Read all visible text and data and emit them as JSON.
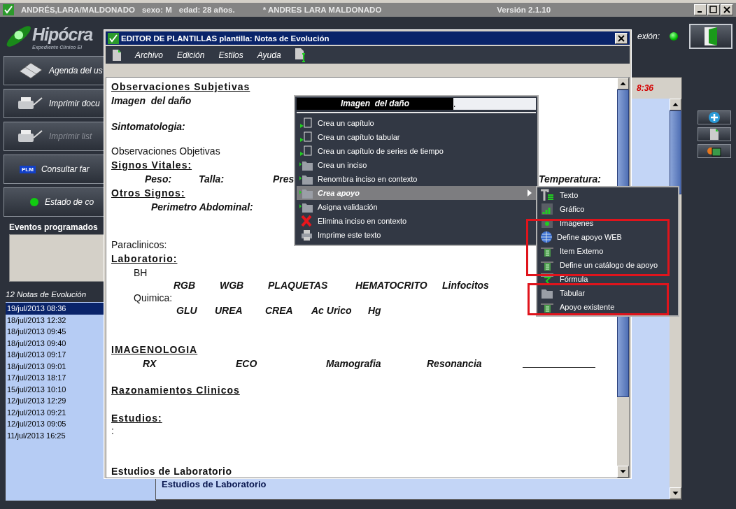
{
  "window": {
    "patient": "ANDRÉS,LARA/MALDONADO",
    "sex": "sexo: M",
    "age": "edad: 28 años.",
    "doctor": "* ANDRES LARA MALDONADO",
    "version": "Versión 2.1.10"
  },
  "logo": {
    "name": "Hipócra",
    "tagline": "Expediente Clínico El"
  },
  "connection": {
    "label": "exión:",
    "on": true
  },
  "nav": [
    {
      "label": "Agenda del us",
      "kind": "agenda",
      "disabled": false
    },
    {
      "label": "Imprimir docu",
      "kind": "printer",
      "disabled": false
    },
    {
      "label": "Imprimir list",
      "kind": "printer",
      "disabled": true
    },
    {
      "label": "Consultar far",
      "kind": "plm",
      "disabled": false
    },
    {
      "label": "Estado de co",
      "kind": "led",
      "disabled": false
    }
  ],
  "plm_badge": "PLM",
  "events": {
    "title": "Eventos programados"
  },
  "notes": {
    "title": "12 Notas de Evolución",
    "items": [
      {
        "label": "19/jul/2013 08:36",
        "selected": true
      },
      {
        "label": "18/jul/2013 12:32",
        "selected": false
      },
      {
        "label": "18/jul/2013 09:45",
        "selected": false
      },
      {
        "label": "18/jul/2013 09:40",
        "selected": false
      },
      {
        "label": "18/jul/2013 09:17",
        "selected": false
      },
      {
        "label": "18/jul/2013 09:01",
        "selected": false
      },
      {
        "label": "17/jul/2013 18:17",
        "selected": false
      },
      {
        "label": "15/jul/2013 10:10",
        "selected": false
      },
      {
        "label": "12/jul/2013 12:29",
        "selected": false
      },
      {
        "label": "12/jul/2013 09:21",
        "selected": false
      },
      {
        "label": "12/jul/2013 09:05",
        "selected": false
      },
      {
        "label": "11/jul/2013 16:25",
        "selected": false
      }
    ]
  },
  "panel": {
    "time": "8:36",
    "footer": "Estudios de Laboratorio"
  },
  "editor": {
    "title": "EDITOR DE PLANTILLAS plantilla: Notas de Evolución",
    "menu": [
      "Archivo",
      "Edición",
      "Estilos",
      "Ayuda"
    ],
    "lines": [
      {
        "kind": "heading",
        "text": "Observaciones Subjetivas"
      },
      {
        "kind": "label",
        "text": "Imagen  del daño"
      },
      {
        "kind": "label",
        "text": "Sintomatologia:"
      },
      {
        "kind": "plain",
        "text": "Observaciones Objetivas"
      },
      {
        "kind": "heading",
        "text": "Signos Vitales:"
      },
      {
        "kind": "fields",
        "items": [
          "Peso:",
          "Talla:",
          "Pres",
          "Temperatura:"
        ]
      },
      {
        "kind": "heading",
        "text": "Otros Signos:"
      },
      {
        "kind": "fields",
        "items": [
          "Perimetro Abdominal:"
        ]
      },
      {
        "kind": "plain",
        "text": "Paraclinicos:"
      },
      {
        "kind": "heading",
        "text": "Laboratorio:"
      },
      {
        "kind": "subplain",
        "text": "BH"
      },
      {
        "kind": "fields",
        "items": [
          "RGB",
          "WGB",
          "PLAQUETAS",
          "HEMATOCRITO",
          "Linfocitos"
        ]
      },
      {
        "kind": "subplain",
        "text": "Quimica:"
      },
      {
        "kind": "fields",
        "items": [
          "GLU",
          "UREA",
          "CREA",
          "Ac Urico",
          "Hg"
        ]
      },
      {
        "kind": "heading",
        "text": "IMAGENOLOGIA"
      },
      {
        "kind": "fields",
        "items": [
          "RX",
          "ECO",
          "Mamografia",
          "Resonancia"
        ],
        "fill_line": true
      },
      {
        "kind": "heading",
        "text": "Razonamientos Clinicos"
      },
      {
        "kind": "heading",
        "text": "Estudios:"
      },
      {
        "kind": "plain",
        "text": ":"
      },
      {
        "kind": "bold",
        "text": "Estudios de Laboratorio"
      }
    ]
  },
  "context_menu": {
    "header": "Imagen  del daño",
    "header_mark": ".",
    "items": [
      {
        "label": "Crea un capítulo",
        "kind": "chapter",
        "selected": false,
        "submenu": false
      },
      {
        "label": "Crea un capítulo tabular",
        "kind": "chapter",
        "selected": false,
        "submenu": false
      },
      {
        "label": "Crea un capítulo de series de tiempo",
        "kind": "chapter",
        "selected": false,
        "submenu": false
      },
      {
        "label": "Crea un inciso",
        "kind": "folder",
        "selected": false,
        "submenu": false
      },
      {
        "label": "Renombra inciso en contexto",
        "kind": "folder",
        "selected": false,
        "submenu": false
      },
      {
        "label": "Crea apoyo",
        "kind": "folder",
        "selected": true,
        "submenu": true
      },
      {
        "label": "Asigna validación",
        "kind": "folder",
        "selected": false,
        "submenu": false
      },
      {
        "label": "Elimina inciso en contexto",
        "kind": "delete",
        "selected": false,
        "submenu": false
      },
      {
        "label": "Imprime este texto",
        "kind": "print",
        "selected": false,
        "submenu": false
      }
    ]
  },
  "submenu": {
    "items": [
      {
        "label": "Texto",
        "kind": "text"
      },
      {
        "label": "Gráfico",
        "kind": "chart"
      },
      {
        "label": "Imágenes",
        "kind": "image"
      },
      {
        "label": "Define apoyo WEB",
        "kind": "web"
      },
      {
        "label": "Item Externo",
        "kind": "item"
      },
      {
        "label": "Define un catálogo de apoyo",
        "kind": "item"
      },
      {
        "label": "Fórmula",
        "kind": "formula"
      },
      {
        "label": "Tabular",
        "kind": "table"
      },
      {
        "label": "Apoyo existente",
        "kind": "item"
      }
    ]
  }
}
